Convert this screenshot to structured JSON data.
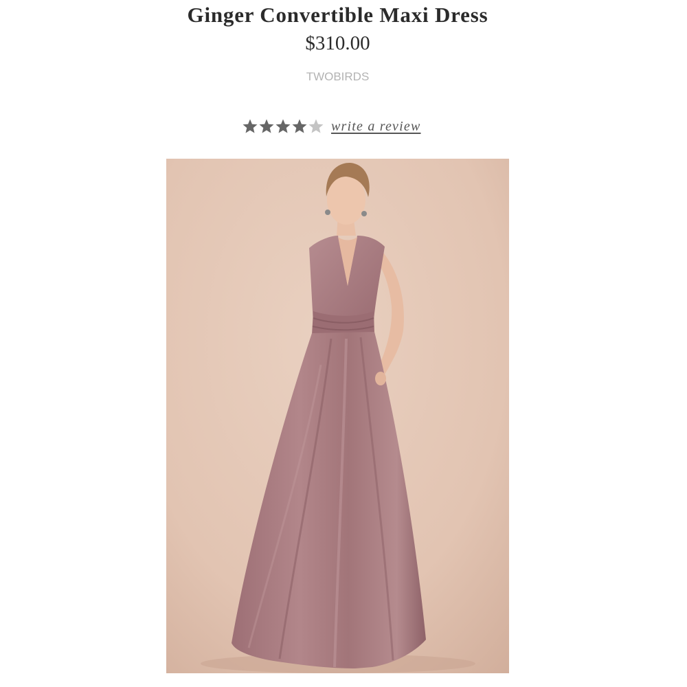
{
  "product": {
    "title": "Ginger Convertible Maxi Dress",
    "price": "$310.00",
    "brand": "TWOBIRDS"
  },
  "rating": {
    "value": 4,
    "max": 5,
    "star_icon": "star-icon",
    "filled_color": "#666666",
    "empty_color": "#c4c4c4",
    "review_link_label": "write a review"
  },
  "image": {
    "backdrop_color": "#e3c7b6",
    "dress_color": "#a5787d"
  }
}
